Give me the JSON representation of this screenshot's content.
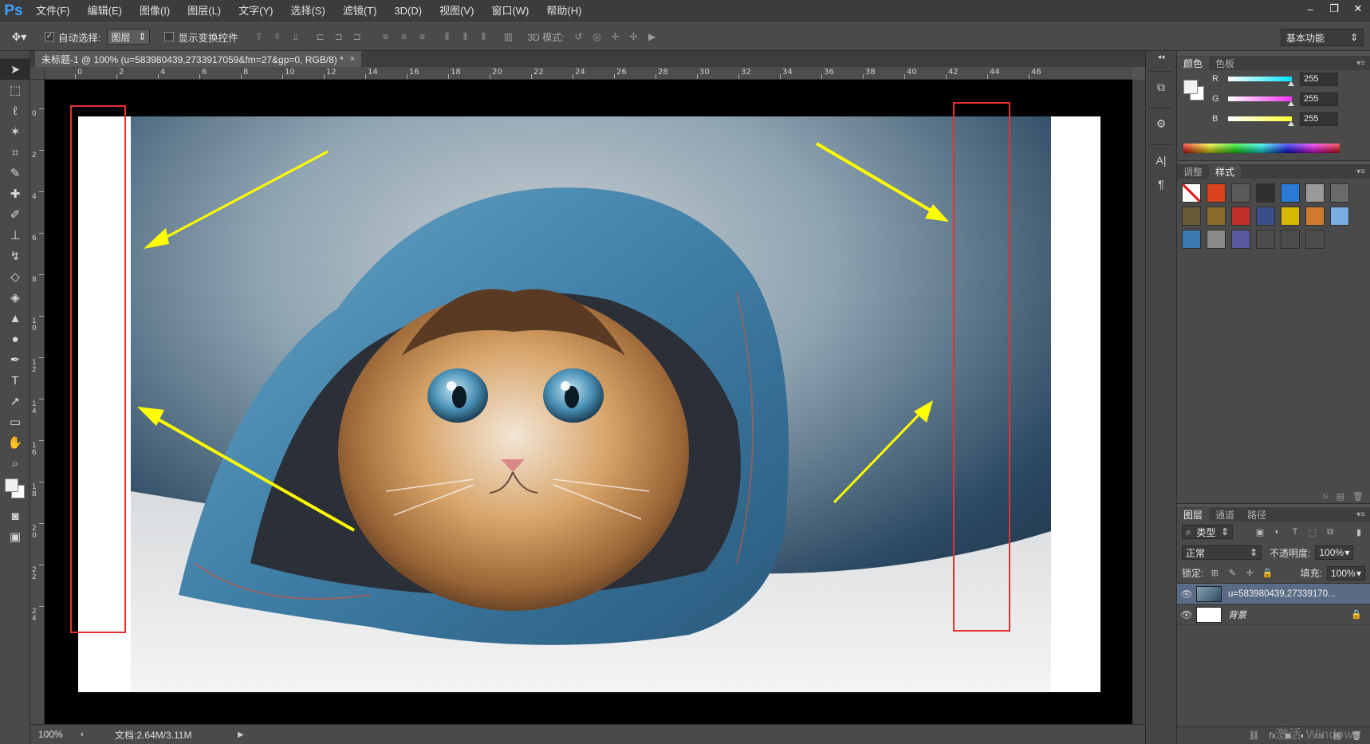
{
  "app": {
    "logo": "Ps",
    "menus": [
      "文件(F)",
      "编辑(E)",
      "图像(I)",
      "图层(L)",
      "文字(Y)",
      "选择(S)",
      "滤镜(T)",
      "3D(D)",
      "视图(V)",
      "窗口(W)",
      "帮助(H)"
    ],
    "window_controls": [
      "–",
      "❐",
      "✕"
    ]
  },
  "options_bar": {
    "auto_select_label": "自动选择:",
    "auto_select_checked": true,
    "auto_select_target": "图层",
    "show_transform_label": "显示变换控件",
    "show_transform_checked": false,
    "mode_3d_label": "3D 模式:",
    "workspace": "基本功能"
  },
  "document": {
    "tab_title": "未标题-1 @ 100% (u=583980439,2733917059&fm=27&gp=0, RGB/8) *",
    "tab_close": "×"
  },
  "rulers": {
    "horizontal": [
      "0",
      "2",
      "4",
      "6",
      "8",
      "10",
      "12",
      "14",
      "16",
      "18",
      "20",
      "22",
      "24",
      "26",
      "28",
      "30",
      "32",
      "34",
      "36",
      "38",
      "40",
      "42",
      "44",
      "46"
    ],
    "vertical": [
      "0",
      "2",
      "4",
      "6",
      "8",
      "10",
      "12",
      "14",
      "16",
      "18",
      "20",
      "22",
      "24"
    ]
  },
  "status": {
    "zoom": "100%",
    "doc_info": "文档:2.64M/3.11M"
  },
  "color_panel": {
    "tabs": [
      "颜色",
      "色板"
    ],
    "channels": [
      {
        "label": "R",
        "value": "255",
        "color": "#00e5ff"
      },
      {
        "label": "G",
        "value": "255",
        "color": "#ff33ff"
      },
      {
        "label": "B",
        "value": "255",
        "color": "#ffff33"
      }
    ]
  },
  "styles_panel": {
    "tabs": [
      "调整",
      "样式"
    ],
    "swatches": [
      "#ffffff",
      "#d9421c",
      "#5a5a5a",
      "#303030",
      "#2a7bd6",
      "#9a9a9a",
      "#6a6a6a",
      "#6b5a3a",
      "#8a6b2a",
      "#c0302a",
      "#3a4f8a",
      "#d8b800",
      "#d07a30",
      "#7aaee0",
      "#3a7ab0",
      "#8a8a8a",
      "#5a5aa0",
      "#4d4d4d",
      "#4d4d4d",
      "#4d4d4d"
    ]
  },
  "layers_panel": {
    "tabs": [
      "图层",
      "通道",
      "路径"
    ],
    "filter_kind": "类型",
    "blend_mode": "正常",
    "opacity_label": "不透明度:",
    "opacity": "100%",
    "lock_label": "锁定:",
    "fill_label": "填充:",
    "fill": "100%",
    "layers": [
      {
        "name": "u=583980439,27339170...",
        "selected": true
      },
      {
        "name": "背景",
        "selected": false
      }
    ],
    "watermark": "激活 Windows"
  },
  "colors": {
    "selection_frame": "#e8302f",
    "arrow": "#ffff00",
    "canvas_black": "#000000"
  }
}
